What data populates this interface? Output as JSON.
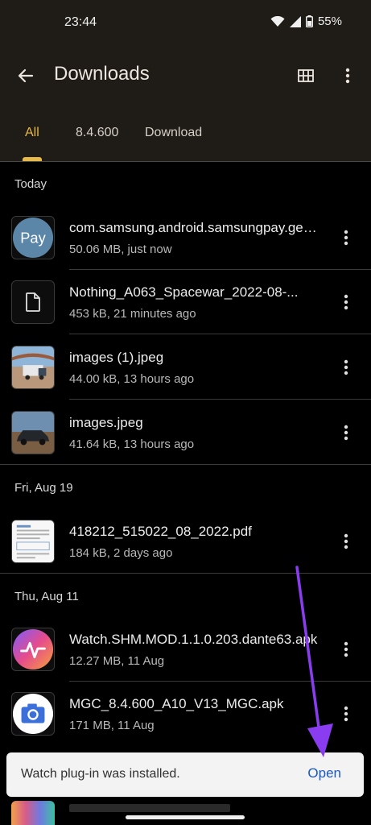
{
  "status_bar": {
    "time": "23:44",
    "battery": "55%"
  },
  "app_bar": {
    "title": "Downloads",
    "back_icon": "arrow-back-icon",
    "view_icon": "grid-view-icon",
    "more_icon": "more-vert-icon"
  },
  "tabs": [
    {
      "label": "All",
      "active": true
    },
    {
      "label": "8.4.600",
      "active": false
    },
    {
      "label": "Download",
      "active": false
    }
  ],
  "sections": [
    {
      "title": "Today",
      "items": [
        {
          "name": "com.samsung.android.samsungpay.gear_...",
          "meta": "50.06 MB, just now",
          "thumb": "pay",
          "thumb_label": "Pay"
        },
        {
          "name": "Nothing_A063_Spacewar_2022-08-...",
          "meta": "453 kB, 21 minutes ago",
          "thumb": "file"
        },
        {
          "name": "images (1).jpeg",
          "meta": "44.00 kB, 13 hours ago",
          "thumb": "truck"
        },
        {
          "name": "images.jpeg",
          "meta": "41.64 kB, 13 hours ago",
          "thumb": "car"
        }
      ]
    },
    {
      "title": "Fri, Aug 19",
      "items": [
        {
          "name": "418212_515022_08_2022.pdf",
          "meta": "184 kB, 2 days ago",
          "thumb": "pdf"
        }
      ]
    },
    {
      "title": "Thu, Aug 11",
      "items": [
        {
          "name": "Watch.SHM.MOD.1.1.0.203.dante63.apk",
          "meta": "12.27 MB, 11 Aug",
          "thumb": "watch"
        },
        {
          "name": "MGC_8.4.600_A10_V13_MGC.apk",
          "meta": "171 MB, 11 Aug",
          "thumb": "camera"
        }
      ]
    }
  ],
  "snackbar": {
    "message": "Watch plug-in was installed.",
    "action": "Open"
  },
  "colors": {
    "header_bg": "#1f1b16",
    "accent": "#e7b84a",
    "snackbar_action": "#1a57c8",
    "annotation_arrow": "#8a3df0"
  }
}
